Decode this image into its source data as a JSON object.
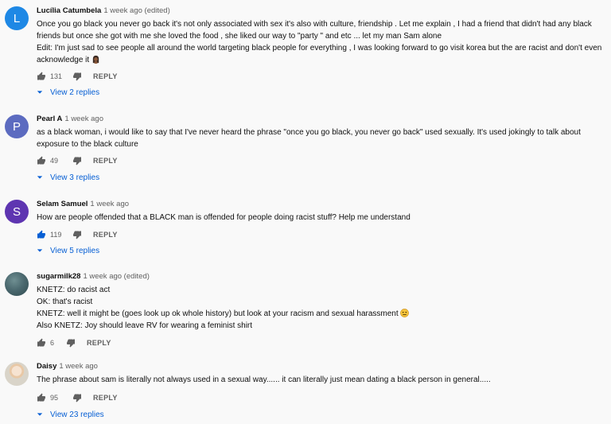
{
  "comments": [
    {
      "author": "Lucília Catumbela",
      "time": "1 week ago (edited)",
      "avatar_letter": "L",
      "avatar_color": "#1e88e5",
      "lines": [
        "Once you go black you never go back it's not only associated with sex it's also with culture, friendship . Let me explain , I had a friend that didn't had any black friends but once she got with me she loved the food , she liked our way to \"party \" and etc ... let my man Sam alone",
        "Edit: I'm just sad to see people all around the world targeting black people for everything , I was looking forward to go visit korea but the are racist and don't even acknowledge it"
      ],
      "likes": "131",
      "reply_label": "REPLY",
      "replies_label": "View 2 replies"
    },
    {
      "author": "Pearl A",
      "time": "1 week ago",
      "avatar_letter": "P",
      "avatar_color": "#5c6bc0",
      "lines": [
        "as a black woman, i would like to say that I've never heard the phrase \"once you go black, you never go back\" used sexually. It's used jokingly to talk about exposure to the black culture"
      ],
      "likes": "49",
      "reply_label": "REPLY",
      "replies_label": "View 3 replies"
    },
    {
      "author": "Selam Samuel",
      "time": "1 week ago",
      "avatar_letter": "S",
      "avatar_color": "#5e35b1",
      "lines": [
        "How are people offended that a BLACK man is offended for people doing racist stuff? Help me understand"
      ],
      "likes": "119",
      "reply_label": "REPLY",
      "replies_label": "View 5 replies"
    },
    {
      "author": "sugarmilk28",
      "time": "1 week ago (edited)",
      "lines": [
        "KNETZ: do racist act",
        "OK: that's racist",
        "KNETZ: well it might be (goes look up ok whole history) but look at your racism and sexual harassment",
        "Also KNETZ: Joy should leave RV for wearing a feminist shirt"
      ],
      "likes": "6",
      "reply_label": "REPLY"
    },
    {
      "author": "Daisy",
      "time": "1 week ago",
      "lines": [
        "The phrase about sam is literally not always used in a sexual way...... it can literally just mean dating a black person in general....."
      ],
      "likes": "95",
      "reply_label": "REPLY",
      "replies_label": "View 23 replies"
    }
  ],
  "colors": {
    "link": "#065fd4",
    "muted": "#606060",
    "background": "#f9f9f9"
  },
  "icons": {
    "like": "thumbs-up-icon",
    "dislike": "thumbs-down-icon",
    "replies_caret": "caret-down-icon"
  }
}
